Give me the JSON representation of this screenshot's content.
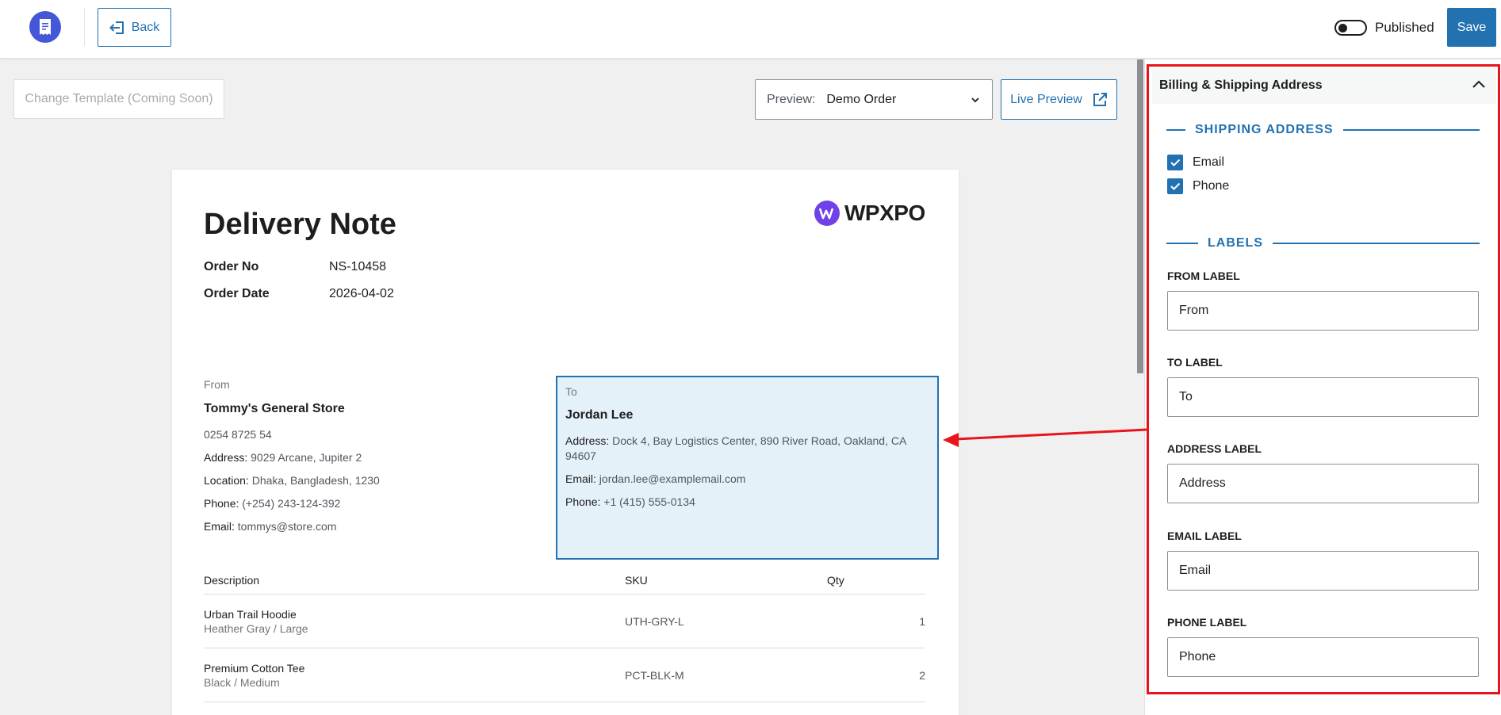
{
  "topbar": {
    "back_label": "Back",
    "published_label": "Published",
    "published_on": false,
    "save_label": "Save"
  },
  "toolbar": {
    "change_template_label": "Change Template (Coming Soon)",
    "preview_label": "Preview:",
    "preview_value": "Demo Order",
    "live_preview_label": "Live Preview"
  },
  "document": {
    "title": "Delivery Note",
    "brand": "WPXPO",
    "order_no_label": "Order No",
    "order_no": "NS-10458",
    "order_date_label": "Order Date",
    "order_date": "2026-04-02",
    "from": {
      "caption": "From",
      "name": "Tommy's General Store",
      "phone_plain": "0254 8725 54",
      "address_label": "Address:",
      "address": "9029 Arcane, Jupiter 2",
      "location_label": "Location:",
      "location": "Dhaka, Bangladesh, 1230",
      "phone_label": "Phone:",
      "phone": "(+254) 243-124-392",
      "email_label": "Email:",
      "email": "tommys@store.com"
    },
    "to": {
      "caption": "To",
      "name": "Jordan Lee",
      "address_label": "Address:",
      "address": "Dock 4, Bay Logistics Center, 890 River Road, Oakland, CA 94607",
      "email_label": "Email:",
      "email": "jordan.lee@examplemail.com",
      "phone_label": "Phone:",
      "phone": "+1 (415) 555-0134"
    },
    "table": {
      "headers": [
        "Description",
        "SKU",
        "Qty"
      ],
      "rows": [
        {
          "name": "Urban Trail Hoodie",
          "variant": "Heather Gray / Large",
          "sku": "UTH-GRY-L",
          "qty": "1"
        },
        {
          "name": "Premium Cotton Tee",
          "variant": "Black / Medium",
          "sku": "PCT-BLK-M",
          "qty": "2"
        }
      ]
    }
  },
  "sidebar": {
    "panel_title": "Billing & Shipping Address",
    "shipping_section": "SHIPPING ADDRESS",
    "checks": [
      {
        "label": "Email",
        "checked": true
      },
      {
        "label": "Phone",
        "checked": true
      }
    ],
    "labels_section": "LABELS",
    "fields": [
      {
        "label": "FROM LABEL",
        "value": "From"
      },
      {
        "label": "TO LABEL",
        "value": "To"
      },
      {
        "label": "ADDRESS LABEL",
        "value": "Address"
      },
      {
        "label": "EMAIL LABEL",
        "value": "Email"
      },
      {
        "label": "PHONE LABEL",
        "value": "Phone"
      }
    ]
  },
  "colors": {
    "accent": "#2271b1",
    "highlight": "#e8141c",
    "logo": "#4457d8",
    "brand_mark": "#6f42e8",
    "selected_block_bg": "#e5f1f8"
  },
  "icons": {
    "logo": "receipt-icon",
    "back": "exit-arrow-icon",
    "preview": "chevron-down-icon",
    "live_preview": "external-link-icon",
    "panel": "chevron-up-icon",
    "check": "checkmark-icon"
  }
}
